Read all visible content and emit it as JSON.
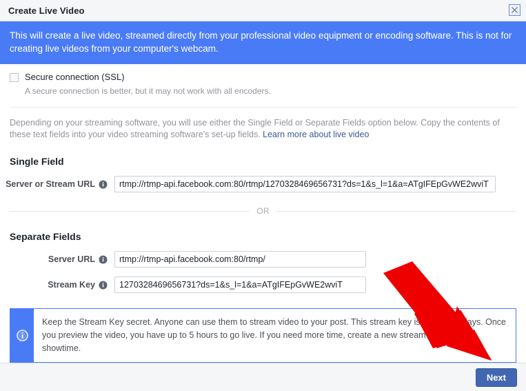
{
  "window": {
    "title": "Create Live Video",
    "close_icon": "close-icon"
  },
  "banner": {
    "text": "This will create a live video, streamed directly from your professional video equipment or encoding software. This is not for creating live videos from your computer's webcam.",
    "background_color": "#4a7bf7",
    "text_color": "#ffffff"
  },
  "ssl": {
    "label": "Secure connection (SSL)",
    "description": "A secure connection is better, but it may not work with all encoders.",
    "checked": false
  },
  "description": {
    "text": "Depending on your streaming software, you will use either the Single Field or Separate Fields option below. Copy the contents of these text fields into your video streaming software's set-up fields. ",
    "link_label": "Learn more about live video",
    "link_color": "#3b5998"
  },
  "single_field": {
    "heading": "Single Field",
    "server_or_stream_url": {
      "label": "Server or Stream URL",
      "value": "rtmp://rtmp-api.facebook.com:80/rtmp/1270328469656731?ds=1&s_l=1&a=ATgIFEpGvWE2wviT",
      "info_icon": "info-icon"
    }
  },
  "or_divider": {
    "label": "OR"
  },
  "separate_fields": {
    "heading": "Separate Fields",
    "server_url": {
      "label": "Server URL",
      "value": "rtmp://rtmp-api.facebook.com:80/rtmp/",
      "info_icon": "info-icon"
    },
    "stream_key": {
      "label": "Stream Key",
      "value": "1270328469656731?ds=1&s_l=1&a=ATgIFEpGvWE2wviT",
      "info_icon": "info-icon"
    }
  },
  "note": {
    "icon": "info-circle-icon",
    "text": "Keep the Stream Key secret. Anyone can use them to stream video to your post. This stream key is valid for 7 days. Once you preview the video, you have up to 5 hours to go live. If you need more time, create a new stream key closer to showtime.",
    "accent_color": "#4a7bf7"
  },
  "footer": {
    "next_label": "Next",
    "next_color": "#4267b2"
  },
  "annotation": {
    "arrow_color": "#ee0000",
    "arrow_direction": "down-right",
    "points_to": "next-button"
  }
}
